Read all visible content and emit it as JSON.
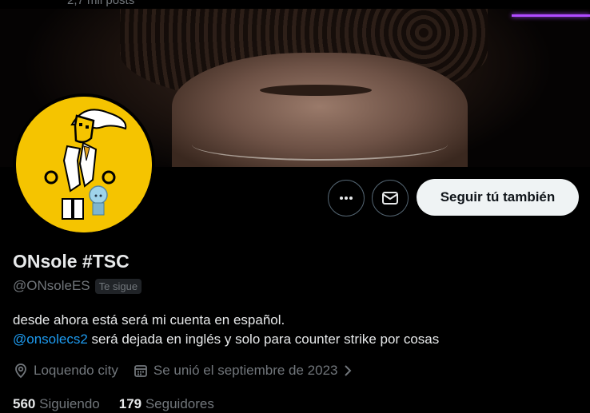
{
  "top": {
    "posts_label": "2,7 mil posts"
  },
  "profile": {
    "display_name": "ONsole #TSC",
    "handle": "@ONsoleES",
    "follows_you": "Te sigue",
    "bio_line1": "desde ahora está será mi cuenta en español.",
    "bio_mention": "@onsolecs2",
    "bio_line2_rest": " será dejada en inglés y solo para counter strike por cosas",
    "location": "Loquendo city",
    "joined": "Se unió el septiembre de 2023",
    "following_count": "560",
    "following_label": "Siguiendo",
    "followers_count": "179",
    "followers_label": "Seguidores"
  },
  "actions": {
    "follow_back": "Seguir tú también"
  },
  "icons": {
    "more": "more-icon",
    "message": "mail-icon",
    "location": "location-pin-icon",
    "calendar": "calendar-icon",
    "chevron": "chevron-right-icon"
  },
  "colors": {
    "background": "#000000",
    "accent": "#1d9bf0",
    "muted": "#71767b",
    "text": "#e7e9ea",
    "follow_button": "#eff3f4",
    "avatar_bg": "#f5c400"
  }
}
